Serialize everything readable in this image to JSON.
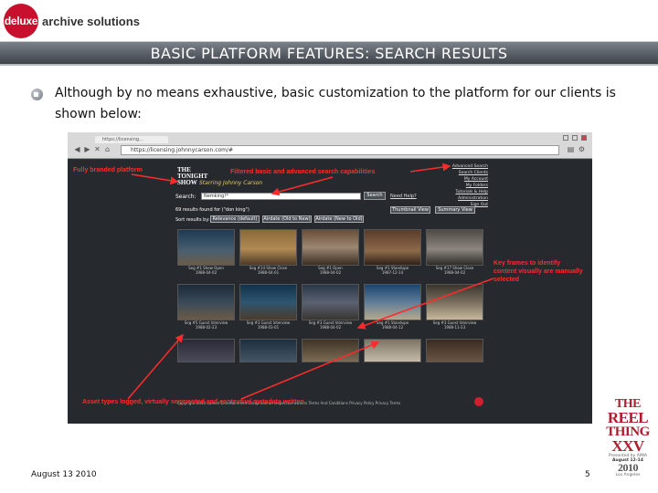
{
  "header": {
    "logo_mark": "deluxe",
    "logo_text": "archive solutions",
    "title": "BASIC PLATFORM FEATURES: SEARCH RESULTS"
  },
  "body": {
    "bullet_text": "Although by no means exhaustive, basic customization to the platform for our clients is shown below:"
  },
  "screenshot": {
    "browser": {
      "tab_label": "https://licensing...",
      "url": "https://licensing.johnnycarson.com/#"
    },
    "site": {
      "logo": "THE TONIGHT SHOW",
      "logo_sub": "Starring Johnny Carson",
      "search_label": "Search:",
      "search_value": "Nemking!*",
      "search_button": "Search",
      "advanced_link": "Need Help?",
      "right_links": [
        "Advanced Search",
        "Search Clients",
        "My Account",
        "My Folders",
        "Tutorials & Help",
        "Administration",
        "Sign Out"
      ],
      "results_text": "69 results found for (\"don king\")",
      "view_buttons": [
        "Thumbnail View",
        "Summary View"
      ],
      "sort_label": "Sort results by:",
      "sort_buttons": [
        "Relevance (default)",
        "Airdate (Old to New)",
        "Airdate (New to Old)"
      ],
      "thumbnails": [
        [
          {
            "caption": "Seg #1 Show Open",
            "date": "1988-04-02"
          },
          {
            "caption": "Seg #14 Show Close",
            "date": "1988-04-01"
          },
          {
            "caption": "Seg #1 Open",
            "date": "1988-04-02"
          },
          {
            "caption": "Seg #1 Standupe",
            "date": "1987-12-14"
          },
          {
            "caption": "Seg #17 Show Close",
            "date": "1988-04-02"
          }
        ],
        [
          {
            "caption": "Seg #5 Guest Interview",
            "date": "1988-02-23"
          },
          {
            "caption": "Seg #3 Guest Interview",
            "date": "1988-03-01"
          },
          {
            "caption": "Seg #3 Guest Interview",
            "date": "1988-04-02"
          },
          {
            "caption": "Seg #1 Standupe",
            "date": "1988-04-12"
          },
          {
            "caption": "Seg #3 Guest Interview",
            "date": "1988-11-23"
          }
        ],
        [
          {
            "caption": "",
            "date": ""
          },
          {
            "caption": "",
            "date": ""
          },
          {
            "caption": "",
            "date": ""
          },
          {
            "caption": "",
            "date": ""
          },
          {
            "caption": "",
            "date": ""
          }
        ]
      ],
      "footer": "Copyright 2010 Carson Entertainment Group and all respective owners   Terms And Conditions   Privacy Policy   Privacy Terms"
    },
    "annotations": {
      "branded": "Fully branded platform",
      "filtered": "Filtered basic and advanced search capabilities",
      "keyframes": "Key frames to identify content visually are manually selected",
      "assets": "Asset types logged, virtually segmented and contextual metadata written"
    },
    "colors": {
      "annotation_red": "#ff2a2a",
      "page_bg": "#262a2e"
    }
  },
  "brand": {
    "line1": "THE",
    "line2": "REEL",
    "line3": "THING",
    "line4": "XXV",
    "presented": "Presented by AMIA",
    "dates": "August 12-14",
    "year": "2010",
    "city": "Los Angeles"
  },
  "footer": {
    "date": "August 13 2010",
    "page": "5"
  }
}
